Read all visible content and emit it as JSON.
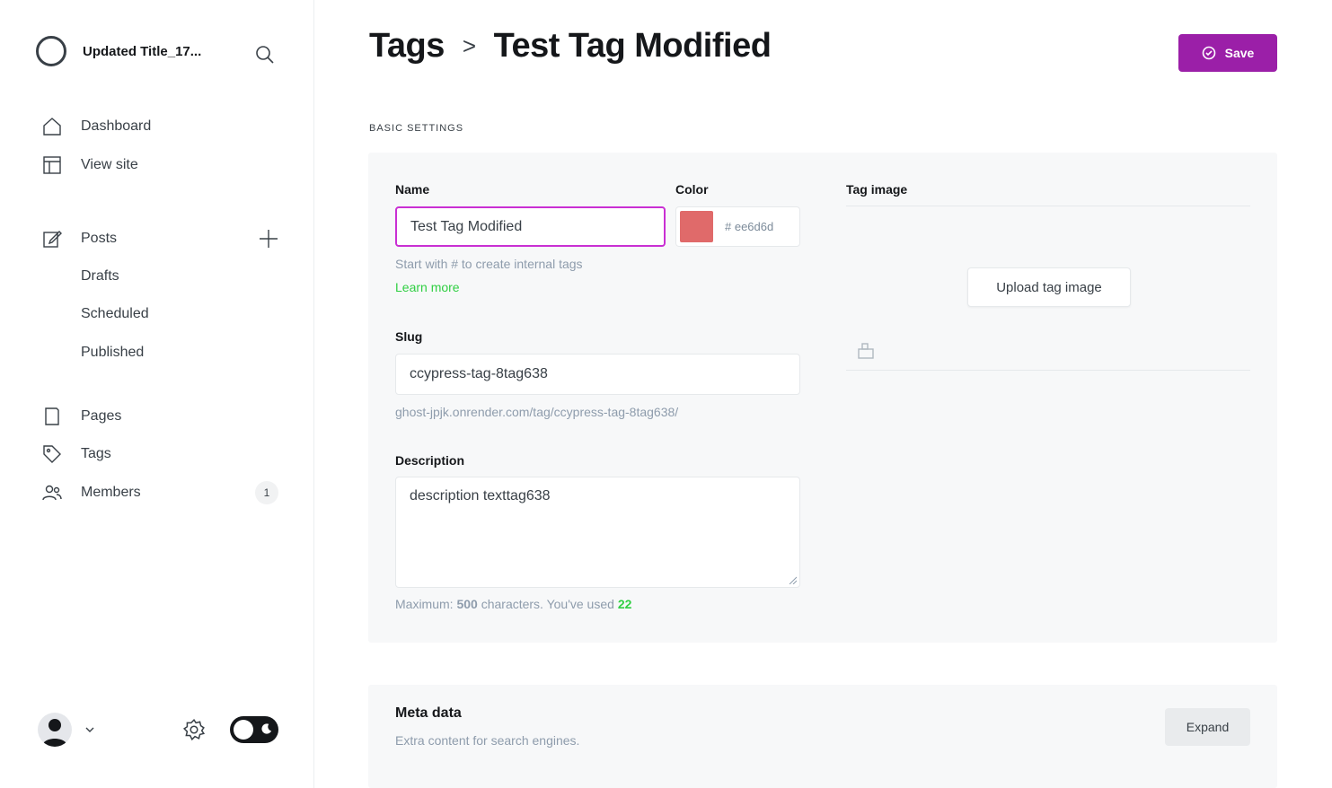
{
  "sidebar": {
    "site_title": "Updated Title_17...",
    "nav": {
      "dashboard": "Dashboard",
      "view_site": "View site",
      "posts": "Posts",
      "drafts": "Drafts",
      "scheduled": "Scheduled",
      "published": "Published",
      "pages": "Pages",
      "tags": "Tags",
      "members": "Members",
      "members_count": "1"
    }
  },
  "header": {
    "breadcrumb_parent": "Tags",
    "breadcrumb_separator": ">",
    "title": "Test Tag Modified",
    "save_label": "Save"
  },
  "basic": {
    "section_label": "BASIC SETTINGS",
    "name_label": "Name",
    "name_value": "Test Tag Modified",
    "color_label": "Color",
    "color_hex": "# ee6d6d",
    "name_help": "Start with # to create internal tags",
    "learn_more": "Learn more",
    "slug_label": "Slug",
    "slug_value": "ccypress-tag-8tag638",
    "slug_url": "ghost-jpjk.onrender.com/tag/ccypress-tag-8tag638/",
    "description_label": "Description",
    "description_value": "description texttag638",
    "desc_help_prefix": "Maximum:",
    "desc_help_max": "500",
    "desc_help_middle": "characters. You've used",
    "desc_help_used": "22",
    "tag_image_label": "Tag image",
    "upload_label": "Upload tag image"
  },
  "meta": {
    "title": "Meta data",
    "subtitle": "Extra content for search engines.",
    "expand_label": "Expand"
  },
  "colors": {
    "accent": "#9b1fa8",
    "swatch": "#ee6d6d",
    "green": "#30cf43"
  }
}
